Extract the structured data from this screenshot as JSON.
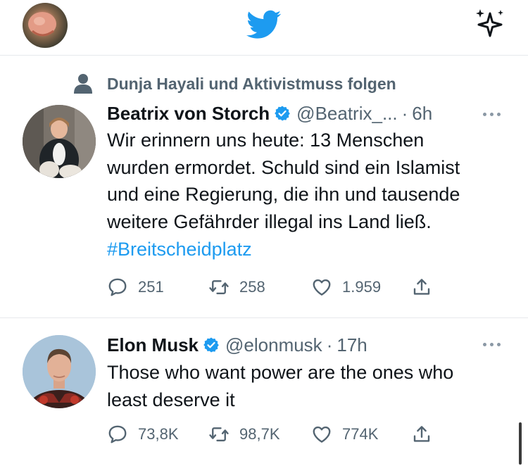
{
  "header": {
    "avatar_icon": "profile-avatar",
    "logo_icon": "twitter-bird-icon",
    "top_tweets_icon": "sparkle-icon",
    "brand_color": "#1d9bf0"
  },
  "tweets": [
    {
      "social_context": "Dunja Hayali und Aktivistmuss folgen",
      "name": "Beatrix von Storch",
      "handle": "@Beatrix_...",
      "dot": "·",
      "time": "6h",
      "lines": [
        "Wir erinnern uns heute: 13 Menschen",
        "wurden ermordet. Schuld sind ein Islamist",
        "und eine Regierung, die ihn und tausende",
        "weitere Gefährder illegal ins Land ließ."
      ],
      "hashtag": "#Breitscheidplatz",
      "replies": "251",
      "retweets": "258",
      "likes": "1.959"
    },
    {
      "name": "Elon Musk",
      "handle": "@elonmusk",
      "dot": "·",
      "time": "17h",
      "lines": [
        "Those who want power are the ones who",
        "least deserve it"
      ],
      "replies": "73,8K",
      "retweets": "98,7K",
      "likes": "774K"
    }
  ]
}
